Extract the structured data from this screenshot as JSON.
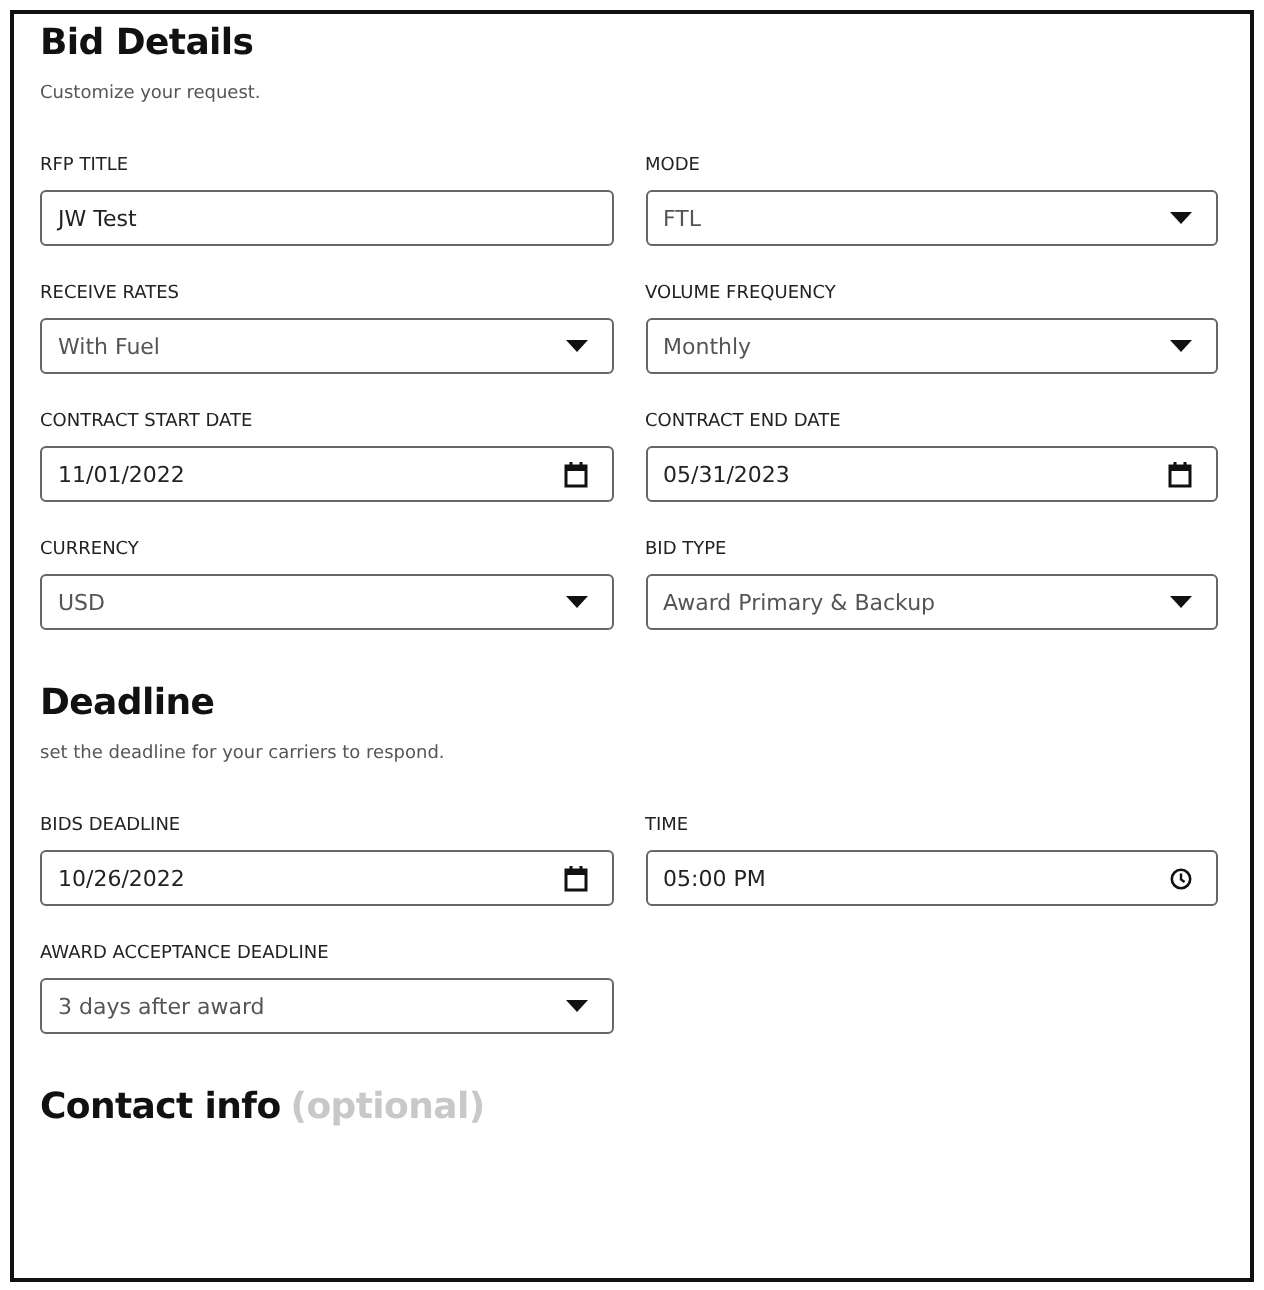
{
  "sections": [
    {
      "title": "Bid Details",
      "subtitle": "Customize your request.",
      "fields": [
        {
          "label": "RFP TITLE",
          "kind": "text",
          "value": "JW Test"
        },
        {
          "label": "MODE",
          "kind": "select",
          "value": "FTL"
        },
        {
          "label": "RECEIVE RATES",
          "kind": "select",
          "value": "With Fuel"
        },
        {
          "label": "VOLUME FREQUENCY",
          "kind": "select",
          "value": "Monthly"
        },
        {
          "label": "CONTRACT START DATE",
          "kind": "date",
          "value": "11/01/2022"
        },
        {
          "label": "CONTRACT END DATE",
          "kind": "date",
          "value": "05/31/2023"
        },
        {
          "label": "CURRENCY",
          "kind": "select",
          "value": "USD"
        },
        {
          "label": "BID TYPE",
          "kind": "select",
          "value": "Award Primary & Backup"
        }
      ]
    },
    {
      "title": "Deadline",
      "subtitle": "set the deadline for your carriers to respond.",
      "fields": [
        {
          "label": "BIDS DEADLINE",
          "kind": "date",
          "value": "10/26/2022"
        },
        {
          "label": "TIME",
          "kind": "time",
          "value": "05:00 PM"
        },
        {
          "label": "AWARD ACCEPTANCE DEADLINE",
          "kind": "select",
          "value": "3 days after award"
        }
      ]
    },
    {
      "title": "Contact info",
      "note": "(optional)"
    }
  ]
}
